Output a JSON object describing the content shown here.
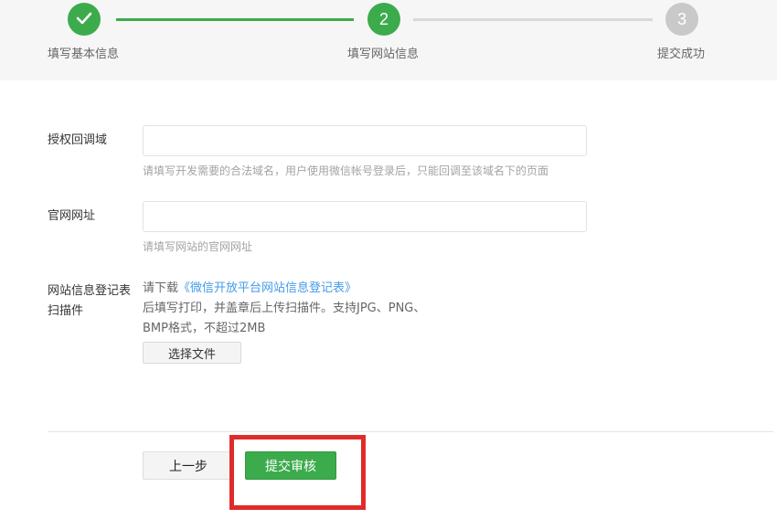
{
  "steps": [
    {
      "number": "",
      "label": "填写基本信息",
      "state": "done",
      "icon": "check-icon"
    },
    {
      "number": "2",
      "label": "填写网站信息",
      "state": "active"
    },
    {
      "number": "3",
      "label": "提交成功",
      "state": "todo"
    }
  ],
  "form": {
    "callback_domain": {
      "label": "授权回调域",
      "value": "",
      "hint": "请填写开发需要的合法域名，用户使用微信帐号登录后，只能回调至该域名下的页面"
    },
    "website_url": {
      "label": "官网网址",
      "value": "",
      "hint": "请填写网站的官网网址"
    },
    "registration_form": {
      "label_line1": "网站信息登记表",
      "label_line2": "扫描件",
      "download_prefix": "请下载",
      "download_link": "《微信开放平台网站信息登记表》",
      "instructions_line1": "后填写打印，并盖章后上传扫描件。支持JPG、PNG、",
      "instructions_line2": "BMP格式，不超过2MB",
      "file_button": "选择文件"
    }
  },
  "actions": {
    "prev_label": "上一步",
    "submit_label": "提交审核"
  },
  "colors": {
    "accent": "#3cab4c",
    "link": "#459ae9",
    "highlight": "#e12b2b"
  }
}
